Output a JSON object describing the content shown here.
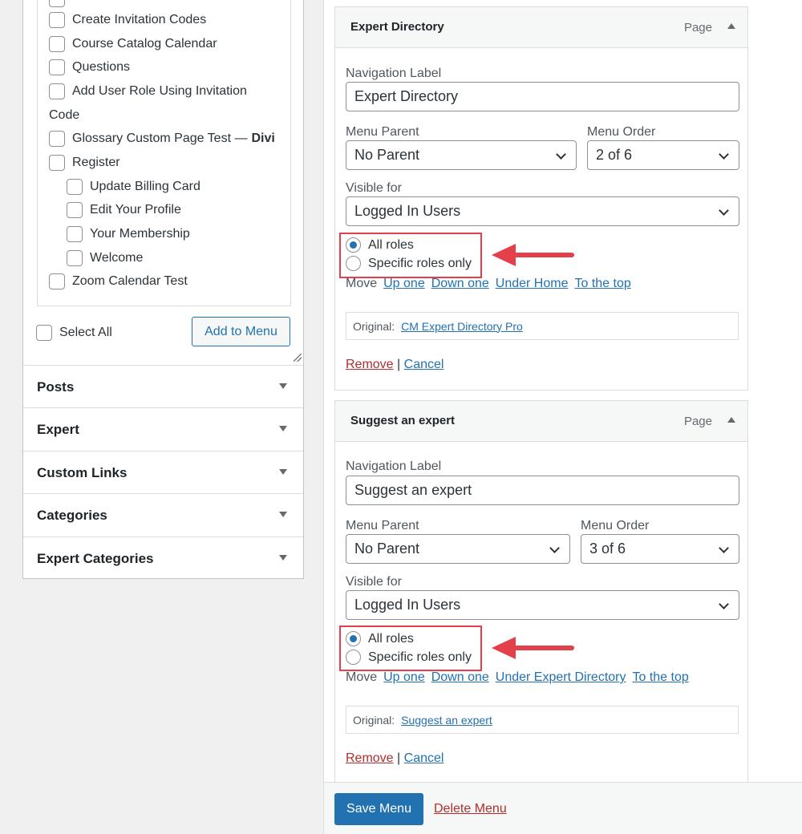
{
  "left_panel": {
    "pages": [
      {
        "label": "Create Invitation Codes"
      },
      {
        "label": "Course Catalog Calendar"
      },
      {
        "label": "Questions"
      },
      {
        "label": "Add User Role Using Invitation"
      },
      {
        "label": "Code"
      },
      {
        "label": "Glossary Custom Page Test —",
        "suffix": "Divi"
      },
      {
        "label": "Register"
      },
      {
        "label": "Update Billing Card"
      },
      {
        "label": "Edit Your Profile"
      },
      {
        "label": "Your Membership"
      },
      {
        "label": "Welcome"
      },
      {
        "label": "Zoom Calendar Test"
      }
    ],
    "select_all_label": "Select All",
    "add_to_menu_label": "Add to Menu",
    "sections": [
      "Posts",
      "Expert",
      "Custom Links",
      "Categories",
      "Expert Categories"
    ]
  },
  "menu_items": [
    {
      "title": "Expert Directory",
      "type": "Page",
      "nav_label_label": "Navigation Label",
      "nav_label_value": "Expert Directory",
      "parent_label": "Menu Parent",
      "parent_value": "No Parent",
      "order_label": "Menu Order",
      "order_value": "2 of 6",
      "visible_label": "Visible for",
      "visible_value": "Logged In Users",
      "radio_all": "All roles",
      "radio_specific": "Specific roles only",
      "move_label": "Move",
      "move_links": [
        "Up one",
        "Down one",
        "Under Home",
        "To the top"
      ],
      "original_label": "Original:",
      "original_link": "CM Expert Directory Pro",
      "remove_label": "Remove",
      "separator": "|",
      "cancel_label": "Cancel"
    },
    {
      "title": "Suggest an expert",
      "type": "Page",
      "nav_label_label": "Navigation Label",
      "nav_label_value": "Suggest an expert",
      "parent_label": "Menu Parent",
      "parent_value": "No Parent",
      "order_label": "Menu Order",
      "order_value": "3 of 6",
      "visible_label": "Visible for",
      "visible_value": "Logged In Users",
      "radio_all": "All roles",
      "radio_specific": "Specific roles only",
      "move_label": "Move",
      "move_links": [
        "Up one",
        "Down one",
        "Under Expert Directory",
        "To the top"
      ],
      "original_label": "Original:",
      "original_link": "Suggest an expert",
      "remove_label": "Remove",
      "separator": "|",
      "cancel_label": "Cancel"
    }
  ],
  "footer": {
    "save_label": "Save Menu",
    "delete_label": "Delete Menu"
  },
  "colors": {
    "accent": "#2271b1",
    "danger": "#b32d2e",
    "annotation": "#e3404b"
  }
}
